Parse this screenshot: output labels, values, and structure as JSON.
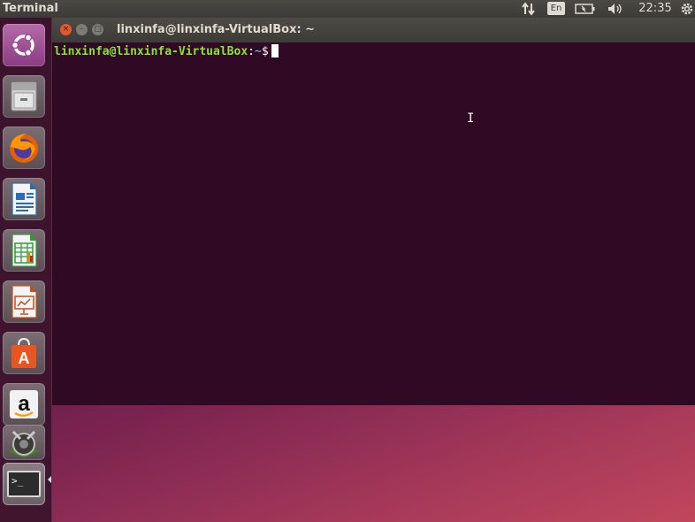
{
  "top_panel": {
    "app_title": "Terminal",
    "network_icon": "network-arrows-icon",
    "keyboard_lang": "En",
    "clock": "22:35"
  },
  "launcher": {
    "items": [
      {
        "name": "ubuntu-dash",
        "icon": "ubuntu-logo-icon"
      },
      {
        "name": "files",
        "icon": "file-cabinet-icon"
      },
      {
        "name": "firefox",
        "icon": "firefox-icon"
      },
      {
        "name": "libreoffice-writer",
        "icon": "writer-doc-icon"
      },
      {
        "name": "libreoffice-calc",
        "icon": "calc-sheet-icon"
      },
      {
        "name": "libreoffice-impress",
        "icon": "impress-slide-icon"
      },
      {
        "name": "ubuntu-software",
        "icon": "shopping-bag-icon"
      },
      {
        "name": "amazon",
        "icon": "amazon-logo-icon"
      },
      {
        "name": "system-settings",
        "icon": "settings-wrench-icon"
      },
      {
        "name": "terminal",
        "icon": "terminal-prompt-icon"
      }
    ],
    "terminal_prompt_glyph": ">_",
    "writer_letter": "",
    "software_letter": "A",
    "amazon_letter": "a"
  },
  "window": {
    "title": "linxinfa@linxinfa-VirtualBox: ~",
    "close_glyph": "×",
    "min_glyph": "–",
    "max_glyph": "□"
  },
  "terminal": {
    "user_host": "linxinfa@linxinfa-VirtualBox",
    "colon": ":",
    "path": "~",
    "dollar": "$"
  },
  "colors": {
    "terminal_bg": "#300a24",
    "prompt_user": "#8ae234",
    "prompt_path": "#729fcf",
    "close_button": "#e3582b"
  }
}
